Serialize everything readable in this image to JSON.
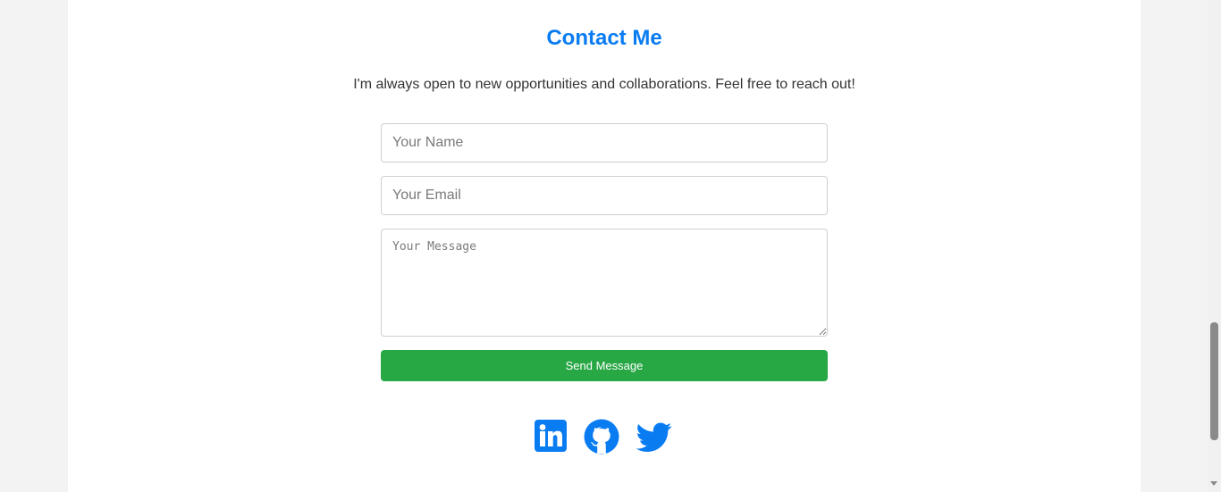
{
  "contact": {
    "title": "Contact Me",
    "intro": "I'm always open to new opportunities and collaborations. Feel free to reach out!",
    "form": {
      "name_placeholder": "Your Name",
      "email_placeholder": "Your Email",
      "message_placeholder": "Your Message",
      "send_label": "Send Message"
    },
    "social": [
      {
        "icon": "linkedin-icon"
      },
      {
        "icon": "github-icon"
      },
      {
        "icon": "twitter-icon"
      }
    ]
  },
  "colors": {
    "accent": "#0a7cf2",
    "button": "#28a745",
    "background": "#f3f3f3"
  }
}
